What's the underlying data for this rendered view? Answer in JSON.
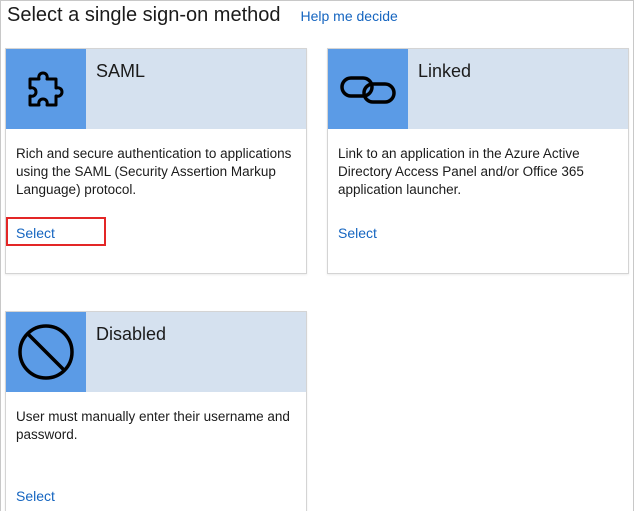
{
  "header": {
    "title": "Select a single sign-on method",
    "help_link": "Help me decide"
  },
  "cards": [
    {
      "title": "SAML",
      "icon": "puzzle-icon",
      "description": "Rich and secure authentication to applications using the SAML (Security Assertion Markup Language) protocol.",
      "select_label": "Select",
      "highlighted": true
    },
    {
      "title": "Linked",
      "icon": "link-icon",
      "description": "Link to an application in the Azure Active Directory Access Panel and/or Office 365 application launcher.",
      "select_label": "Select",
      "highlighted": false
    },
    {
      "title": "Disabled",
      "icon": "disabled-icon",
      "description": "User must manually enter their username and password.",
      "select_label": "Select",
      "highlighted": false
    }
  ],
  "colors": {
    "icon_tile": "#5b9be6",
    "card_header": "#d5e1ef",
    "link": "#1565c0",
    "highlight_border": "#e32626"
  }
}
